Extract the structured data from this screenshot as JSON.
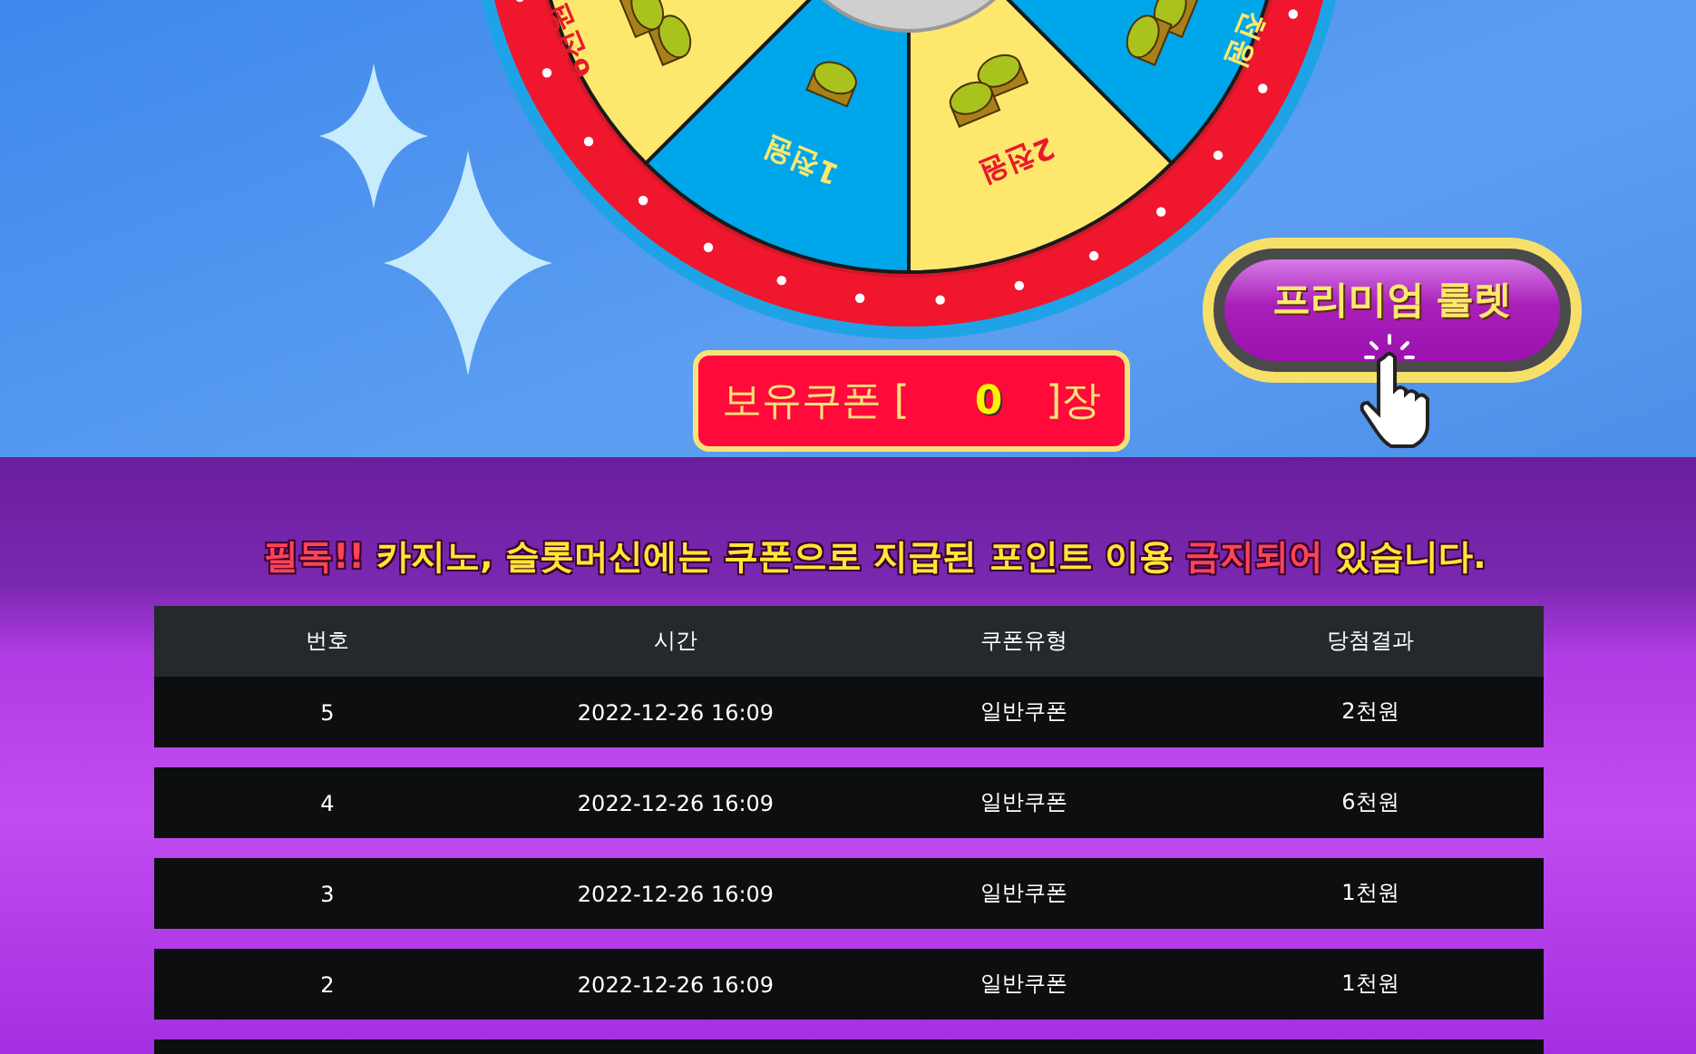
{
  "wheel": {
    "segments": [
      {
        "label": "천원",
        "color": "#00a6ea"
      },
      {
        "label": "2천원",
        "color": "#fde86d"
      },
      {
        "label": "1천원",
        "color": "#00a6ea"
      },
      {
        "label": "6천원",
        "color": "#fde86d"
      }
    ]
  },
  "coupon": {
    "label": "보유쿠폰 [",
    "count": "0",
    "suffix": "]장"
  },
  "premium_button": {
    "label": "프리미엄 룰렛"
  },
  "notice": {
    "parts": [
      {
        "text": "필독!!",
        "color": "#ff4454"
      },
      {
        "text": " 카지노, 슬롯머신에는 쿠폰으로 지급된 포인트 이용 ",
        "color": "#ffe633"
      },
      {
        "text": "금지되어",
        "color": "#ff4454"
      },
      {
        "text": " 있습니다.",
        "color": "#ffe633"
      }
    ]
  },
  "table": {
    "columns": [
      "번호",
      "시간",
      "쿠폰유형",
      "당첨결과"
    ],
    "rows": [
      [
        "5",
        "2022-12-26 16:09",
        "일반쿠폰",
        "2천원"
      ],
      [
        "4",
        "2022-12-26 16:09",
        "일반쿠폰",
        "6천원"
      ],
      [
        "3",
        "2022-12-26 16:09",
        "일반쿠폰",
        "1천원"
      ],
      [
        "2",
        "2022-12-26 16:09",
        "일반쿠폰",
        "1천원"
      ]
    ]
  }
}
